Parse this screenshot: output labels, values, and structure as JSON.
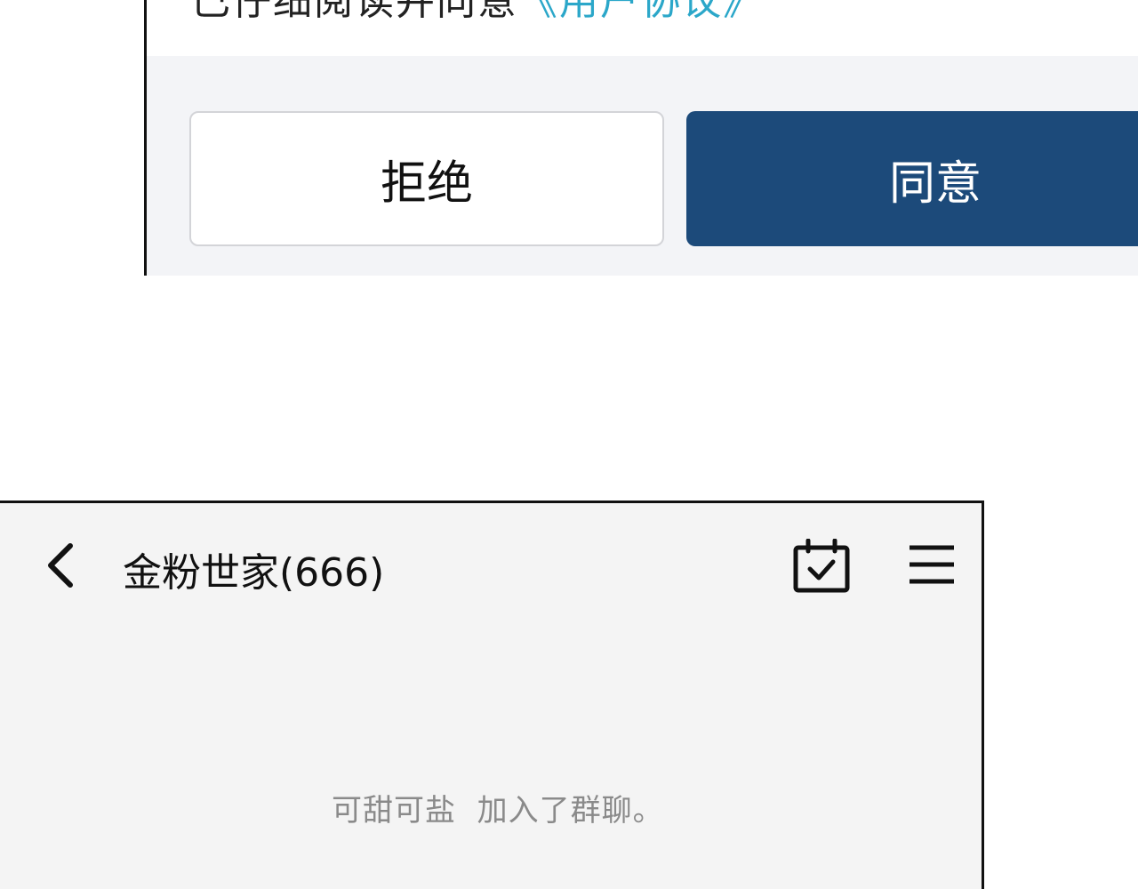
{
  "dialog": {
    "cut_text": "已仔细阅读并同意",
    "cut_link": "《用户协议》",
    "reject_label": "拒绝",
    "agree_label": "同意"
  },
  "chat": {
    "title": "金粉世家(666)",
    "system_message": "可甜可盐  加入了群聊。",
    "icons": {
      "back": "chevron-left-icon",
      "calendar": "calendar-check-icon",
      "menu": "hamburger-menu-icon"
    }
  },
  "colors": {
    "agree_button": "#1c4a7a",
    "dialog_footer": "#f3f4f7",
    "chat_background": "#f4f4f4",
    "system_text": "#8a8a8a",
    "link": "#2ba7c9"
  }
}
